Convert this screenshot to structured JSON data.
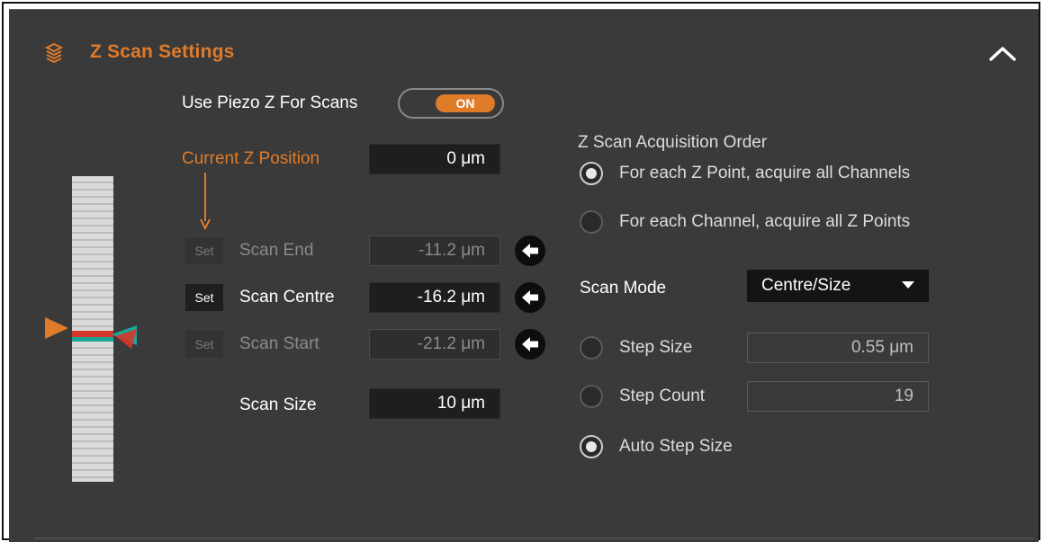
{
  "panel": {
    "title": "Z Scan Settings",
    "header_icon": "layers-icon",
    "collapse_icon": "chevron-up-icon"
  },
  "piezo": {
    "label": "Use Piezo Z For Scans",
    "toggle_value": "ON"
  },
  "current_z": {
    "label": "Current Z Position",
    "value": "0 μm"
  },
  "scan_end": {
    "set_label": "Set",
    "label": "Scan End",
    "value": "-11.2 μm"
  },
  "scan_centre": {
    "set_label": "Set",
    "label": "Scan Centre",
    "value": "-16.2 μm"
  },
  "scan_start": {
    "set_label": "Set",
    "label": "Scan Start",
    "value": "-21.2 μm"
  },
  "scan_size": {
    "label": "Scan Size",
    "value": "10 μm"
  },
  "acquisition_order": {
    "heading": "Z Scan Acquisition Order",
    "options": [
      {
        "label": "For each Z Point, acquire all Channels",
        "selected": true
      },
      {
        "label": "For each Channel, acquire all Z Points",
        "selected": false
      }
    ]
  },
  "scan_mode": {
    "label": "Scan Mode",
    "value": "Centre/Size"
  },
  "step": {
    "step_size_label": "Step Size",
    "step_size_value": "0.55 μm",
    "step_count_label": "Step Count",
    "step_count_value": "19",
    "auto_label": "Auto Step Size",
    "selected": "auto"
  },
  "colors": {
    "accent": "#e07b2a",
    "panel_bg": "#3a3a3a",
    "marker_red": "#d8352a",
    "marker_teal": "#1aa79a"
  }
}
